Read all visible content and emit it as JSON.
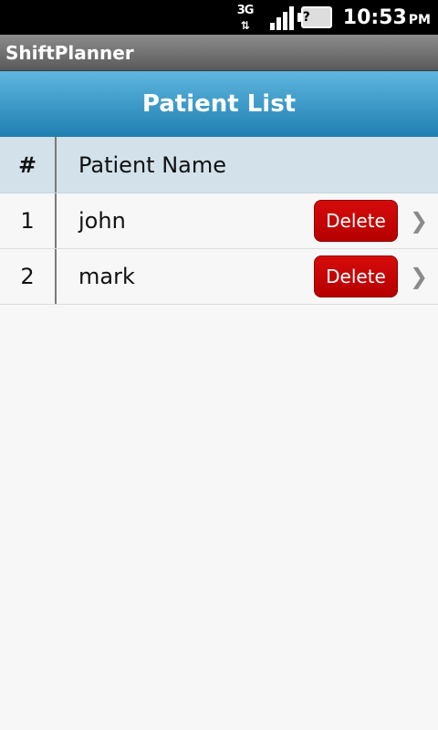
{
  "status_bar": {
    "network": "3G",
    "time": "10:53",
    "ampm": "PM"
  },
  "app": {
    "title": "ShiftPlanner"
  },
  "header": {
    "title": "Patient List"
  },
  "table": {
    "columns": [
      "#",
      "Patient Name"
    ],
    "rows": [
      {
        "num": "1",
        "name": "john",
        "action": "Delete"
      },
      {
        "num": "2",
        "name": "mark",
        "action": "Delete"
      }
    ]
  },
  "colors": {
    "header_blue": "#1f7fb1",
    "delete_red": "#c20000",
    "table_head": "#d2e1ea"
  }
}
